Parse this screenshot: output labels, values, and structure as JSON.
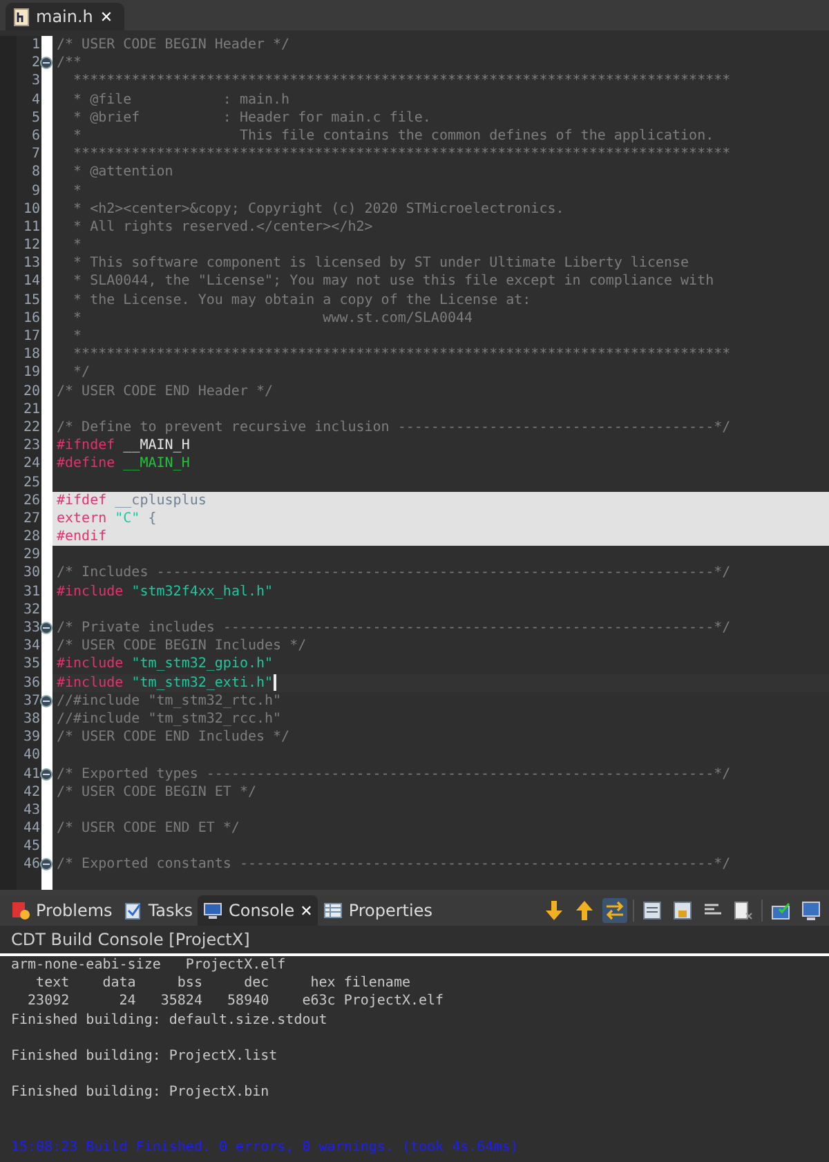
{
  "editor_tab": {
    "label": "main.h",
    "close": "✕",
    "selected": true
  },
  "code_lines": [
    {
      "number": "1",
      "tokens": [
        {
          "kind": "comment",
          "text": "/* USER CODE BEGIN Header */"
        }
      ]
    },
    {
      "number": "2",
      "foldable": true,
      "tokens": [
        {
          "kind": "comment",
          "text": "/**"
        }
      ]
    },
    {
      "number": "3",
      "tokens": [
        {
          "kind": "comment",
          "text": "  *******************************************************************************"
        }
      ]
    },
    {
      "number": "4",
      "tokens": [
        {
          "kind": "comment",
          "text": "  * @file           : main.h"
        }
      ]
    },
    {
      "number": "5",
      "tokens": [
        {
          "kind": "comment",
          "text": "  * @brief          : Header for main.c file."
        }
      ]
    },
    {
      "number": "6",
      "tokens": [
        {
          "kind": "comment",
          "text": "  *                   This file contains the common defines of the application."
        }
      ]
    },
    {
      "number": "7",
      "tokens": [
        {
          "kind": "comment",
          "text": "  *******************************************************************************"
        }
      ]
    },
    {
      "number": "8",
      "tokens": [
        {
          "kind": "comment",
          "text": "  * @attention"
        }
      ]
    },
    {
      "number": "9",
      "tokens": [
        {
          "kind": "comment",
          "text": "  *"
        }
      ]
    },
    {
      "number": "10",
      "tokens": [
        {
          "kind": "comment",
          "text": "  * <h2><center>&copy; Copyright (c) 2020 STMicroelectronics."
        }
      ]
    },
    {
      "number": "11",
      "tokens": [
        {
          "kind": "comment",
          "text": "  * All rights reserved.</center></h2>"
        }
      ]
    },
    {
      "number": "12",
      "tokens": [
        {
          "kind": "comment",
          "text": "  *"
        }
      ]
    },
    {
      "number": "13",
      "tokens": [
        {
          "kind": "comment",
          "text": "  * This software component is licensed by ST under Ultimate Liberty license"
        }
      ]
    },
    {
      "number": "14",
      "tokens": [
        {
          "kind": "comment",
          "text": "  * SLA0044, the \"License\"; You may not use this file except in compliance with"
        }
      ]
    },
    {
      "number": "15",
      "tokens": [
        {
          "kind": "comment",
          "text": "  * the License. You may obtain a copy of the License at:"
        }
      ]
    },
    {
      "number": "16",
      "tokens": [
        {
          "kind": "comment",
          "text": "  *                             www.st.com/SLA0044"
        }
      ]
    },
    {
      "number": "17",
      "tokens": [
        {
          "kind": "comment",
          "text": "  *"
        }
      ]
    },
    {
      "number": "18",
      "tokens": [
        {
          "kind": "comment",
          "text": "  *******************************************************************************"
        }
      ]
    },
    {
      "number": "19",
      "tokens": [
        {
          "kind": "comment",
          "text": "  */"
        }
      ]
    },
    {
      "number": "20",
      "tokens": [
        {
          "kind": "comment",
          "text": "/* USER CODE END Header */"
        }
      ]
    },
    {
      "number": "21"
    },
    {
      "number": "22",
      "tokens": [
        {
          "kind": "comment",
          "text": "/* Define to prevent recursive inclusion --------------------------------------*/"
        }
      ]
    },
    {
      "number": "23",
      "tokens": [
        {
          "kind": "directive",
          "text": "#ifndef"
        },
        {
          "kind": "macro",
          "text": " __MAIN_H"
        }
      ]
    },
    {
      "number": "24",
      "tokens": [
        {
          "kind": "directive",
          "text": "#define"
        },
        {
          "kind": "macrodef",
          "text": " __MAIN_H"
        }
      ]
    },
    {
      "number": "25"
    },
    {
      "number": "26",
      "highlighted": true,
      "tokens": [
        {
          "kind": "directive",
          "text": "#ifdef"
        },
        {
          "kind": "macro",
          "text": " __cplusplus"
        }
      ]
    },
    {
      "number": "27",
      "highlighted": true,
      "tokens": [
        {
          "kind": "directive",
          "text": "extern"
        },
        {
          "kind": "string",
          "text": " \"C\""
        },
        {
          "kind": "macro",
          "text": " {"
        }
      ]
    },
    {
      "number": "28",
      "highlighted": true,
      "tokens": [
        {
          "kind": "directive",
          "text": "#endif"
        }
      ]
    },
    {
      "number": "29"
    },
    {
      "number": "30",
      "tokens": [
        {
          "kind": "comment",
          "text": "/* Includes -------------------------------------------------------------------*/"
        }
      ]
    },
    {
      "number": "31",
      "tokens": [
        {
          "kind": "directive",
          "text": "#include"
        },
        {
          "kind": "string",
          "text": " \"stm32f4xx_hal.h\""
        }
      ]
    },
    {
      "number": "32"
    },
    {
      "number": "33",
      "foldable": true,
      "tokens": [
        {
          "kind": "comment",
          "text": "/* Private includes -----------------------------------------------------------*/"
        }
      ]
    },
    {
      "number": "34",
      "tokens": [
        {
          "kind": "comment",
          "text": "/* USER CODE BEGIN Includes */"
        }
      ]
    },
    {
      "number": "35",
      "tokens": [
        {
          "kind": "directive",
          "text": "#include"
        },
        {
          "kind": "string",
          "text": " \"tm_stm32_gpio.h\""
        }
      ]
    },
    {
      "number": "36",
      "current": true,
      "tokens": [
        {
          "kind": "directive",
          "text": "#include"
        },
        {
          "kind": "string",
          "text": " \"tm_stm32_exti.h\""
        }
      ]
    },
    {
      "number": "37",
      "foldable": true,
      "tokens": [
        {
          "kind": "comment",
          "text": "//#include \"tm_stm32_rtc.h\""
        }
      ]
    },
    {
      "number": "38",
      "tokens": [
        {
          "kind": "comment",
          "text": "//#include \"tm_stm32_rcc.h\""
        }
      ]
    },
    {
      "number": "39",
      "tokens": [
        {
          "kind": "comment",
          "text": "/* USER CODE END Includes */"
        }
      ]
    },
    {
      "number": "40"
    },
    {
      "number": "41",
      "foldable": true,
      "tokens": [
        {
          "kind": "comment",
          "text": "/* Exported types -------------------------------------------------------------*/"
        }
      ]
    },
    {
      "number": "42",
      "tokens": [
        {
          "kind": "comment",
          "text": "/* USER CODE BEGIN ET */"
        }
      ]
    },
    {
      "number": "43"
    },
    {
      "number": "44",
      "tokens": [
        {
          "kind": "comment",
          "text": "/* USER CODE END ET */"
        }
      ]
    },
    {
      "number": "45"
    },
    {
      "number": "46",
      "foldable": true,
      "tokens": [
        {
          "kind": "comment",
          "text": "/* Exported constants ---------------------------------------------------------*/"
        }
      ]
    }
  ],
  "panel_tabs": [
    {
      "label": "Problems",
      "selected": false
    },
    {
      "label": "Tasks",
      "selected": false
    },
    {
      "label": "Console",
      "selected": true,
      "close": "✕"
    },
    {
      "label": "Properties",
      "selected": false
    }
  ],
  "toolbar_groups": [
    [
      {
        "pressed": false
      },
      {
        "pressed": false
      },
      {
        "pressed": true
      }
    ],
    [
      {
        "pressed": false
      },
      {
        "pressed": false
      },
      {
        "pressed": false
      },
      {
        "pressed": false
      }
    ],
    [
      {
        "pressed": false
      },
      {
        "pressed": false
      }
    ]
  ],
  "console": {
    "title": "CDT Build Console [ProjectX]",
    "lines": [
      {
        "kind": "output",
        "text": "arm-none-eabi-size   ProjectX.elf"
      },
      {
        "kind": "output",
        "text": "   text    data     bss     dec     hex filename"
      },
      {
        "kind": "output",
        "text": "  23092      24   35824   58940    e63c ProjectX.elf"
      },
      {
        "kind": "output",
        "text": "Finished building: default.size.stdout"
      },
      {
        "kind": "blank"
      },
      {
        "kind": "output",
        "text": "Finished building: ProjectX.list"
      },
      {
        "kind": "blank"
      },
      {
        "kind": "output",
        "text": "Finished building: ProjectX.bin"
      },
      {
        "kind": "blank"
      },
      {
        "kind": "blank"
      },
      {
        "kind": "status",
        "text": "15:08:23 Build Finished. 0 errors, 0 warnings. (took 4s.64ms)"
      }
    ]
  }
}
